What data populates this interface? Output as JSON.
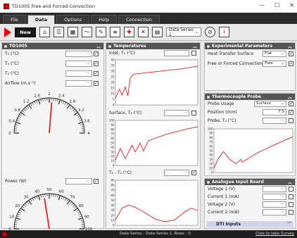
{
  "window": {
    "title": "TD1005 Free and Forced Convection",
    "minimize": "—",
    "maximize": "☐",
    "close": "✕"
  },
  "menu": {
    "tabs": [
      "File",
      "Data",
      "Options",
      "Help",
      "Connection"
    ],
    "active": "Data"
  },
  "toolbar": {
    "new_label": "New",
    "data_series": "Data Series 1"
  },
  "left_panel": {
    "title": "TD1005",
    "t1_label": "T₁ (°C)",
    "t2_label": "T₂ (°C)",
    "t3_label": "T₃ (°C)",
    "airflow_label": "Airflow (m.s⁻¹)",
    "power_label": "Power (W)",
    "airflow_gauge": {
      "ticks": [
        "0",
        "0.4",
        "0.8",
        "1.2",
        "1.6",
        "2",
        "2.4",
        "2.8",
        "3.2",
        "3.6",
        "4"
      ],
      "value": 2.1
    },
    "power_gauge": {
      "ticks": [
        "0",
        "10",
        "20",
        "30",
        "40",
        "50",
        "60",
        "70",
        "80",
        "90",
        "100"
      ],
      "value": 45
    }
  },
  "temps_panel": {
    "title": "Temperatures",
    "inlet_label": "Inlet, T₁ (°C)",
    "surface_label": "Surface, T₂ (°C)",
    "diff_label": "T₂ - T₁ (°C)",
    "inlet_y_ticks": [
      "40",
      "35",
      "30",
      "25",
      "20",
      "15",
      "10",
      "5",
      "0"
    ],
    "surface_y_ticks": [
      "100",
      "90",
      "80",
      "70",
      "60",
      "50",
      "40",
      "30",
      "20",
      "10",
      "0"
    ],
    "diff_y_ticks": [
      "90",
      "80",
      "70",
      "60",
      "50",
      "40",
      "30",
      "20",
      "10",
      "0"
    ]
  },
  "exp_panel": {
    "title": "Experimental Parameters",
    "heat_surface_label": "Heat Transfer Surface",
    "heat_surface_value": "Flat",
    "convection_label": "Free or Forced Convection",
    "convection_value": "Free"
  },
  "probe_panel": {
    "title": "Thermocouple Probe",
    "usage_label": "Probe Usage",
    "usage_value": "Surface",
    "position_label": "Position  (mm)",
    "position_value": "7.5",
    "probe_label": "Probe, T₃ (°C)",
    "y_ticks": [
      "100",
      "90",
      "80",
      "70",
      "60",
      "50",
      "40",
      "30",
      "20",
      "10",
      "0"
    ]
  },
  "analogue_panel": {
    "title": "Analogue Input Board",
    "rows": [
      "Voltage 1 (V)",
      "Current 1 (mA)",
      "Voltage 2 (V)",
      "Current 2 (mA)"
    ],
    "dti_label": "DTI Inputs"
  },
  "status": {
    "text": "Data Series : Data Series 1,  Rows : 0",
    "link": "Click to take Survey"
  },
  "colors": {
    "accent": "#e00000",
    "header": "#555555",
    "plot_line": "#e02020"
  }
}
